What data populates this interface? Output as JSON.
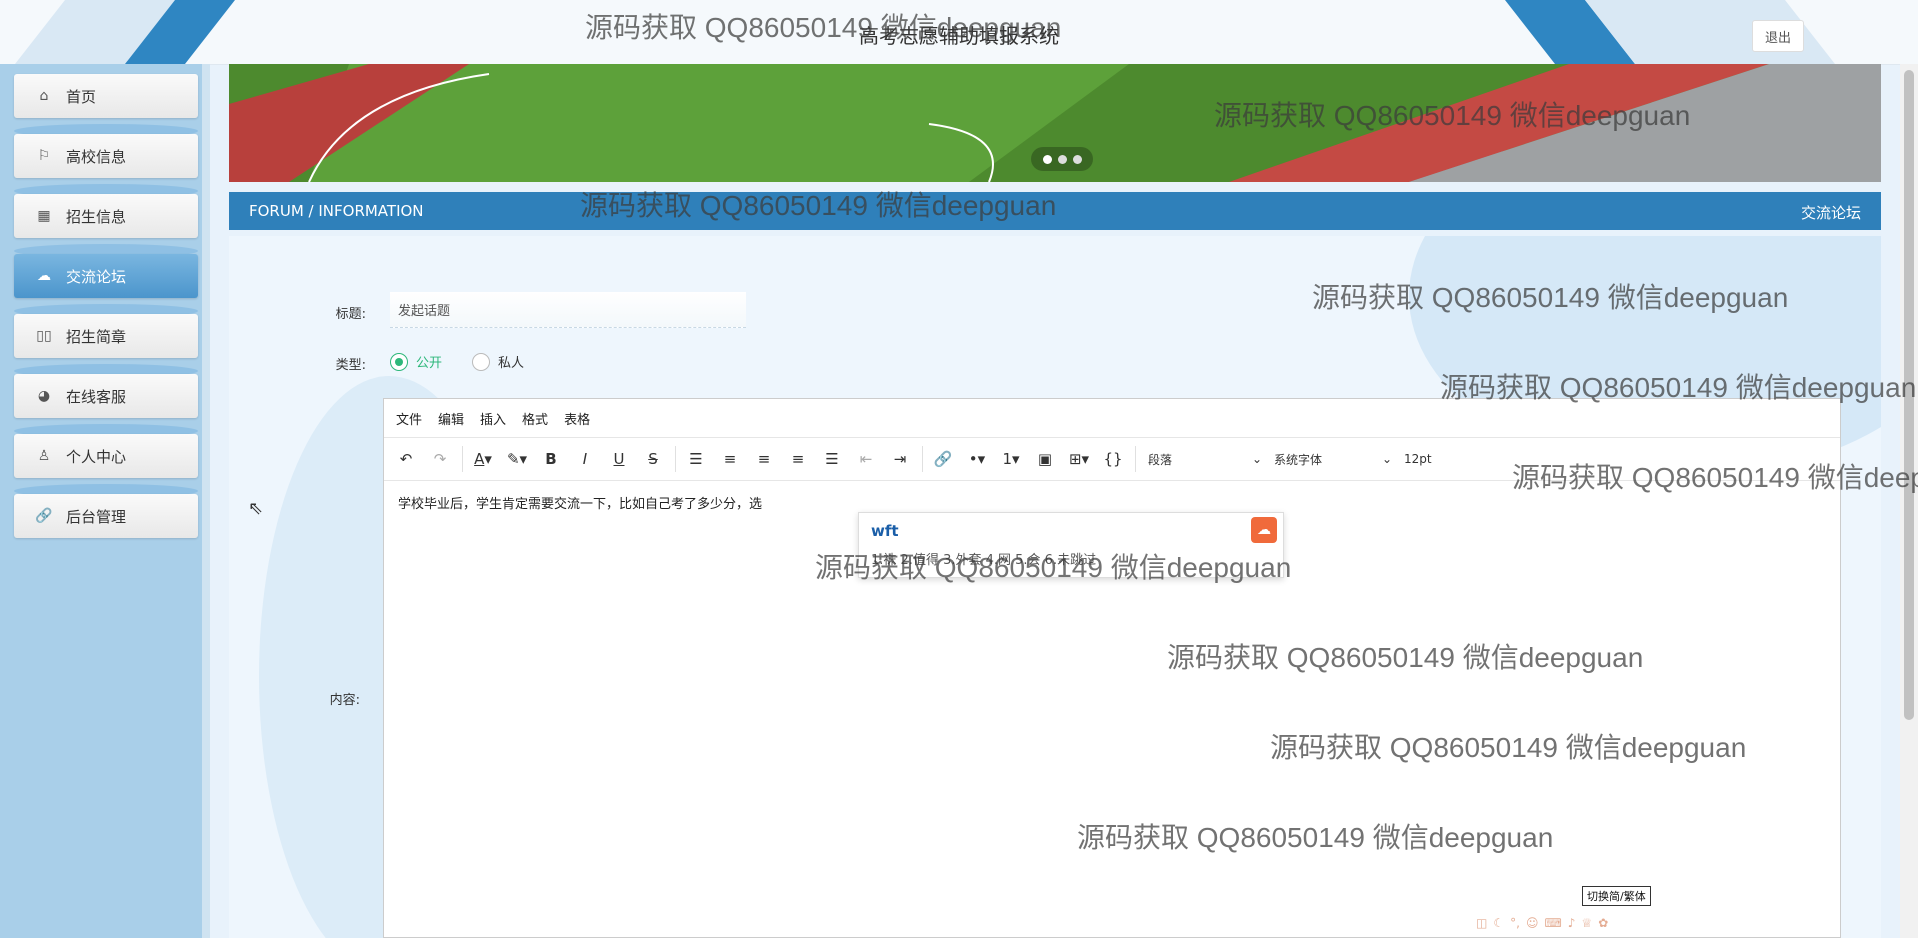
{
  "header": {
    "title": "高考志愿辅助填报系统",
    "logout_label": "退出"
  },
  "sidebar": {
    "items": [
      {
        "label": "首页",
        "icon": "home-icon",
        "glyph": "⌂"
      },
      {
        "label": "高校信息",
        "icon": "flag-icon",
        "glyph": "⚐"
      },
      {
        "label": "招生信息",
        "icon": "calendar-icon",
        "glyph": "▦"
      },
      {
        "label": "交流论坛",
        "icon": "palette-icon",
        "glyph": "☁",
        "active": true
      },
      {
        "label": "招生简章",
        "icon": "book-icon",
        "glyph": "▯▯"
      },
      {
        "label": "在线客服",
        "icon": "headset-icon",
        "glyph": "◕"
      },
      {
        "label": "个人中心",
        "icon": "user-icon",
        "glyph": "♙"
      },
      {
        "label": "后台管理",
        "icon": "link-icon",
        "glyph": "🔗"
      }
    ]
  },
  "section": {
    "left": "FORUM / INFORMATION",
    "right": "交流论坛"
  },
  "form": {
    "title_label": "标题:",
    "title_value": "发起话题",
    "type_label": "类型:",
    "type_options": [
      "公开",
      "私人"
    ],
    "type_selected": "公开",
    "content_label": "内容:"
  },
  "editor": {
    "menu": [
      "文件",
      "编辑",
      "插入",
      "格式",
      "表格"
    ],
    "block_format": "段落",
    "font_family": "系统字体",
    "font_size": "12pt",
    "body_text": "学校毕业后，学生肯定需要交流一下，比如自己考了多少分，选"
  },
  "ime": {
    "input": "wft",
    "candidates": "1.袜  2.值得  3.外套  4.网  5.会  6.未跳过",
    "toggle_tooltip": "切换简/繁体"
  },
  "watermark": "源码获取 QQ86050149 微信deepguan"
}
